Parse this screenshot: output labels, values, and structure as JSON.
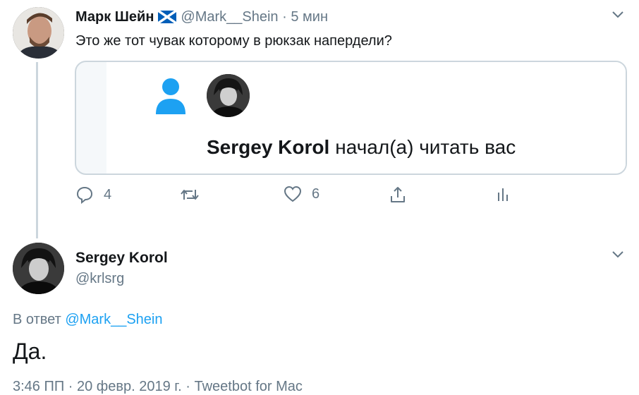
{
  "tweet1": {
    "author_name": "Марк Шейн",
    "flag_icon": "scotland-flag-icon",
    "handle": "@Mark__Shein",
    "separator": "·",
    "time": "5 мин",
    "text": "Это же тот чувак которому в рюкзак напердели?",
    "quoted_card": {
      "user_name": "Sergey Korol",
      "action_text": "начал(а) читать вас"
    },
    "actions": {
      "reply_count": "4",
      "like_count": "6"
    }
  },
  "tweet2": {
    "author_name": "Sergey Korol",
    "handle": "@krlsrg",
    "reply_prefix": "В ответ",
    "reply_to": "@Mark__Shein",
    "text": "Да.",
    "meta": "3:46 ПП · 20 февр. 2019 г. · Tweetbot for Mac"
  },
  "colors": {
    "accent": "#1da1f2",
    "muted": "#657786",
    "border": "#ccd6dd",
    "flag_blue": "#005eb8"
  }
}
